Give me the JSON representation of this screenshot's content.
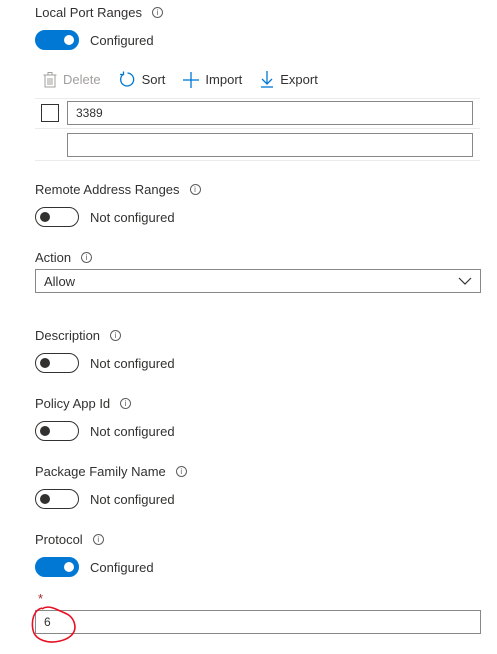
{
  "local_port_ranges": {
    "label": "Local Port Ranges",
    "info_icon": "info-icon",
    "toggle_text": "Configured",
    "toolbar": {
      "delete_label": "Delete",
      "sort_label": "Sort",
      "import_label": "Import",
      "export_label": "Export"
    },
    "rows": [
      {
        "value": "3389"
      },
      {
        "value": ""
      }
    ]
  },
  "remote_address_ranges": {
    "label": "Remote Address Ranges",
    "toggle_text": "Not configured"
  },
  "action": {
    "label": "Action",
    "selected": "Allow"
  },
  "description": {
    "label": "Description",
    "toggle_text": "Not configured"
  },
  "policy_app_id": {
    "label": "Policy App Id",
    "toggle_text": "Not configured"
  },
  "package_family_name": {
    "label": "Package Family Name",
    "toggle_text": "Not configured"
  },
  "protocol": {
    "label": "Protocol",
    "toggle_text": "Configured",
    "required_marker": "*",
    "value": "6"
  },
  "colors": {
    "accent": "#0078d4",
    "required": "#a4262c",
    "annotation": "#e81123"
  }
}
